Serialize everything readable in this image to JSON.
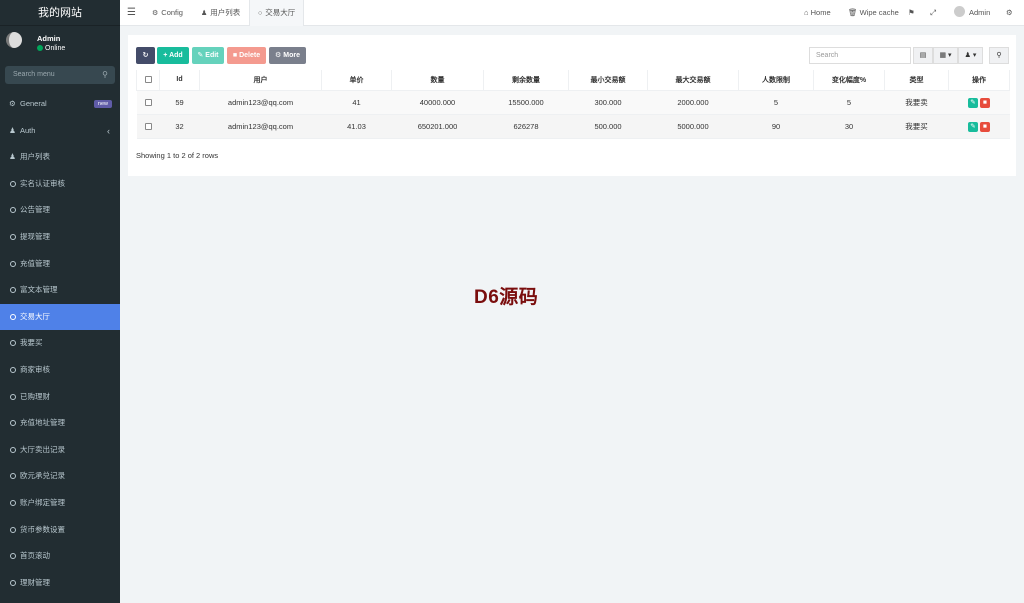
{
  "sidebar": {
    "logo": "我的网站",
    "user_name": "Admin",
    "user_status": "Online",
    "search_placeholder": "Search menu",
    "items": [
      {
        "label": "General",
        "badge": "new"
      },
      {
        "label": "Auth"
      },
      {
        "label": "用户列表"
      },
      {
        "label": "实名认证审核"
      },
      {
        "label": "公告管理"
      },
      {
        "label": "提现管理"
      },
      {
        "label": "充值管理"
      },
      {
        "label": "富文本管理"
      },
      {
        "label": "交易大厅"
      },
      {
        "label": "我要买"
      },
      {
        "label": "商家审核"
      },
      {
        "label": "已购理财"
      },
      {
        "label": "充值地址管理"
      },
      {
        "label": "大厅卖出记录"
      },
      {
        "label": "欧元承兑记录"
      },
      {
        "label": "账户绑定管理"
      },
      {
        "label": "货币参数设置"
      },
      {
        "label": "首页滚动"
      },
      {
        "label": "理财管理"
      }
    ]
  },
  "navbar": {
    "tabs": [
      "Config",
      "用户列表",
      "交易大厅"
    ],
    "home": "Home",
    "wipe_cache": "Wipe cache",
    "admin": "Admin"
  },
  "toolbar": {
    "add": "Add",
    "edit": "Edit",
    "delete": "Delete",
    "more": "More",
    "search_placeholder": "Search"
  },
  "table": {
    "headers": [
      "Id",
      "用户",
      "单价",
      "数量",
      "剩余数量",
      "最小交易额",
      "最大交易额",
      "人数限制",
      "变化幅度%",
      "类型",
      "操作"
    ],
    "rows": [
      [
        "59",
        "admin123@qq.com",
        "41",
        "40000.000",
        "15500.000",
        "300.000",
        "2000.000",
        "5",
        "5",
        "我要卖"
      ],
      [
        "32",
        "admin123@qq.com",
        "41.03",
        "650201.000",
        "626278",
        "500.000",
        "5000.000",
        "90",
        "30",
        "我要买"
      ]
    ],
    "footer": "Showing 1 to 2 of 2 rows"
  },
  "watermark": "D6源码",
  "colors": {
    "sidebar_bg": "#222d32",
    "active_menu": "#4f81e8",
    "add_btn": "#18bc9c",
    "delete_btn": "#f49a8f"
  }
}
